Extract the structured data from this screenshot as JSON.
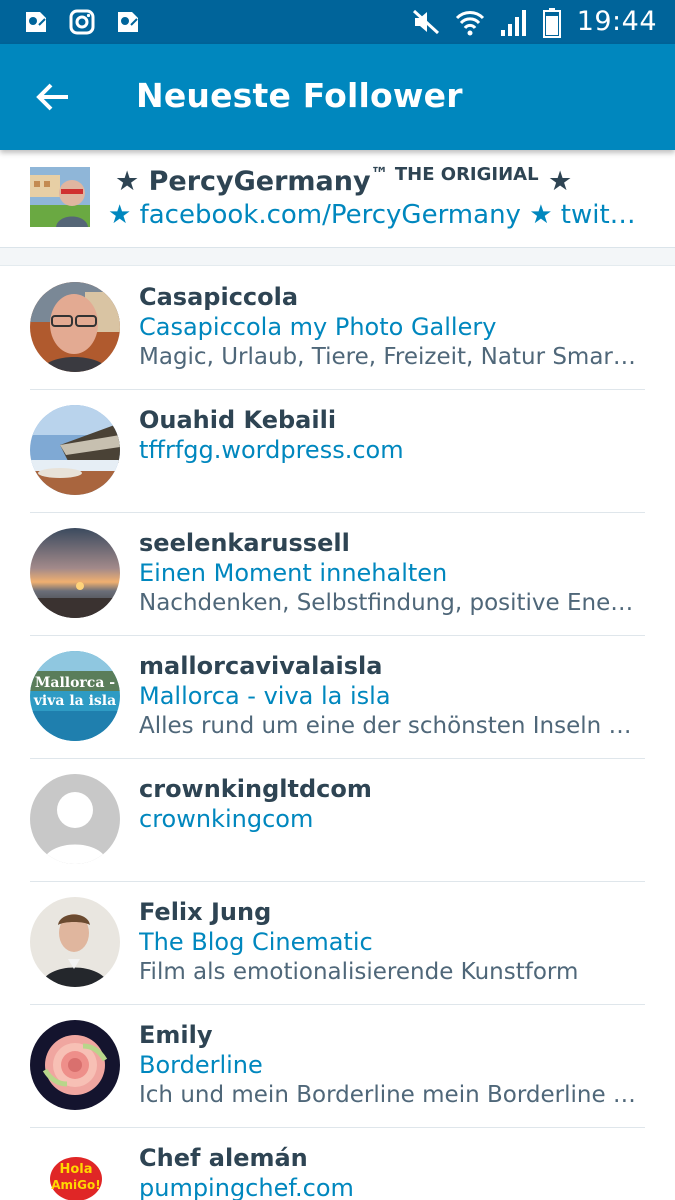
{
  "status_bar": {
    "time": "19:44",
    "left_icons": [
      "maps-icon",
      "instagram-icon",
      "maps-icon"
    ],
    "right_icons": [
      "mute-icon",
      "wifi-icon",
      "signal-icon",
      "battery-icon"
    ]
  },
  "app_bar": {
    "title": "Neueste Follower",
    "back_icon": "arrow-back-icon"
  },
  "blog_header": {
    "title_prefix": "★ PercyGermany",
    "title_tm": "™ THE ORIGIИAL",
    "title_suffix": " ★",
    "url": "★ facebook.com/PercyGermany ★ twitter.com/PercyGermany"
  },
  "followers": [
    {
      "name": "Casapiccola",
      "site": "Casapiccola my Photo Gallery",
      "description": "Magic, Urlaub, Tiere, Freizeit, Natur Smartphone Photography"
    },
    {
      "name": "Ouahid Kebaili",
      "site": "tffrfgg.wordpress.com",
      "description": ""
    },
    {
      "name": "seelenkarussell",
      "site": "Einen Moment innehalten",
      "description": "Nachdenken, Selbstfindung, positive Energie"
    },
    {
      "name": "mallorcavivalaisla",
      "site": "Mallorca - viva la isla",
      "description": "Alles rund um eine der schönsten Inseln der Welt"
    },
    {
      "name": "crownkingltdcom",
      "site": "crownkingcom",
      "description": ""
    },
    {
      "name": "Felix Jung",
      "site": "The Blog Cinematic",
      "description": "Film als emotionalisierende Kunstform"
    },
    {
      "name": "Emily",
      "site": "Borderline",
      "description": "Ich und mein Borderline mein Borderline und ich"
    },
    {
      "name": "Chef alemán",
      "site": "pumpingchef.com",
      "description": ""
    }
  ],
  "avatar_texts": {
    "mallorca_line1": "Mallorca -",
    "mallorca_line2": "viva la isla",
    "hola_line1": "Hola",
    "hola_line2": "AmiGo!"
  },
  "colors": {
    "status_bar": "#00649a",
    "app_bar": "#0087be",
    "link": "#0087be",
    "text_dark": "#2e4453",
    "text_muted": "#4f6779"
  }
}
